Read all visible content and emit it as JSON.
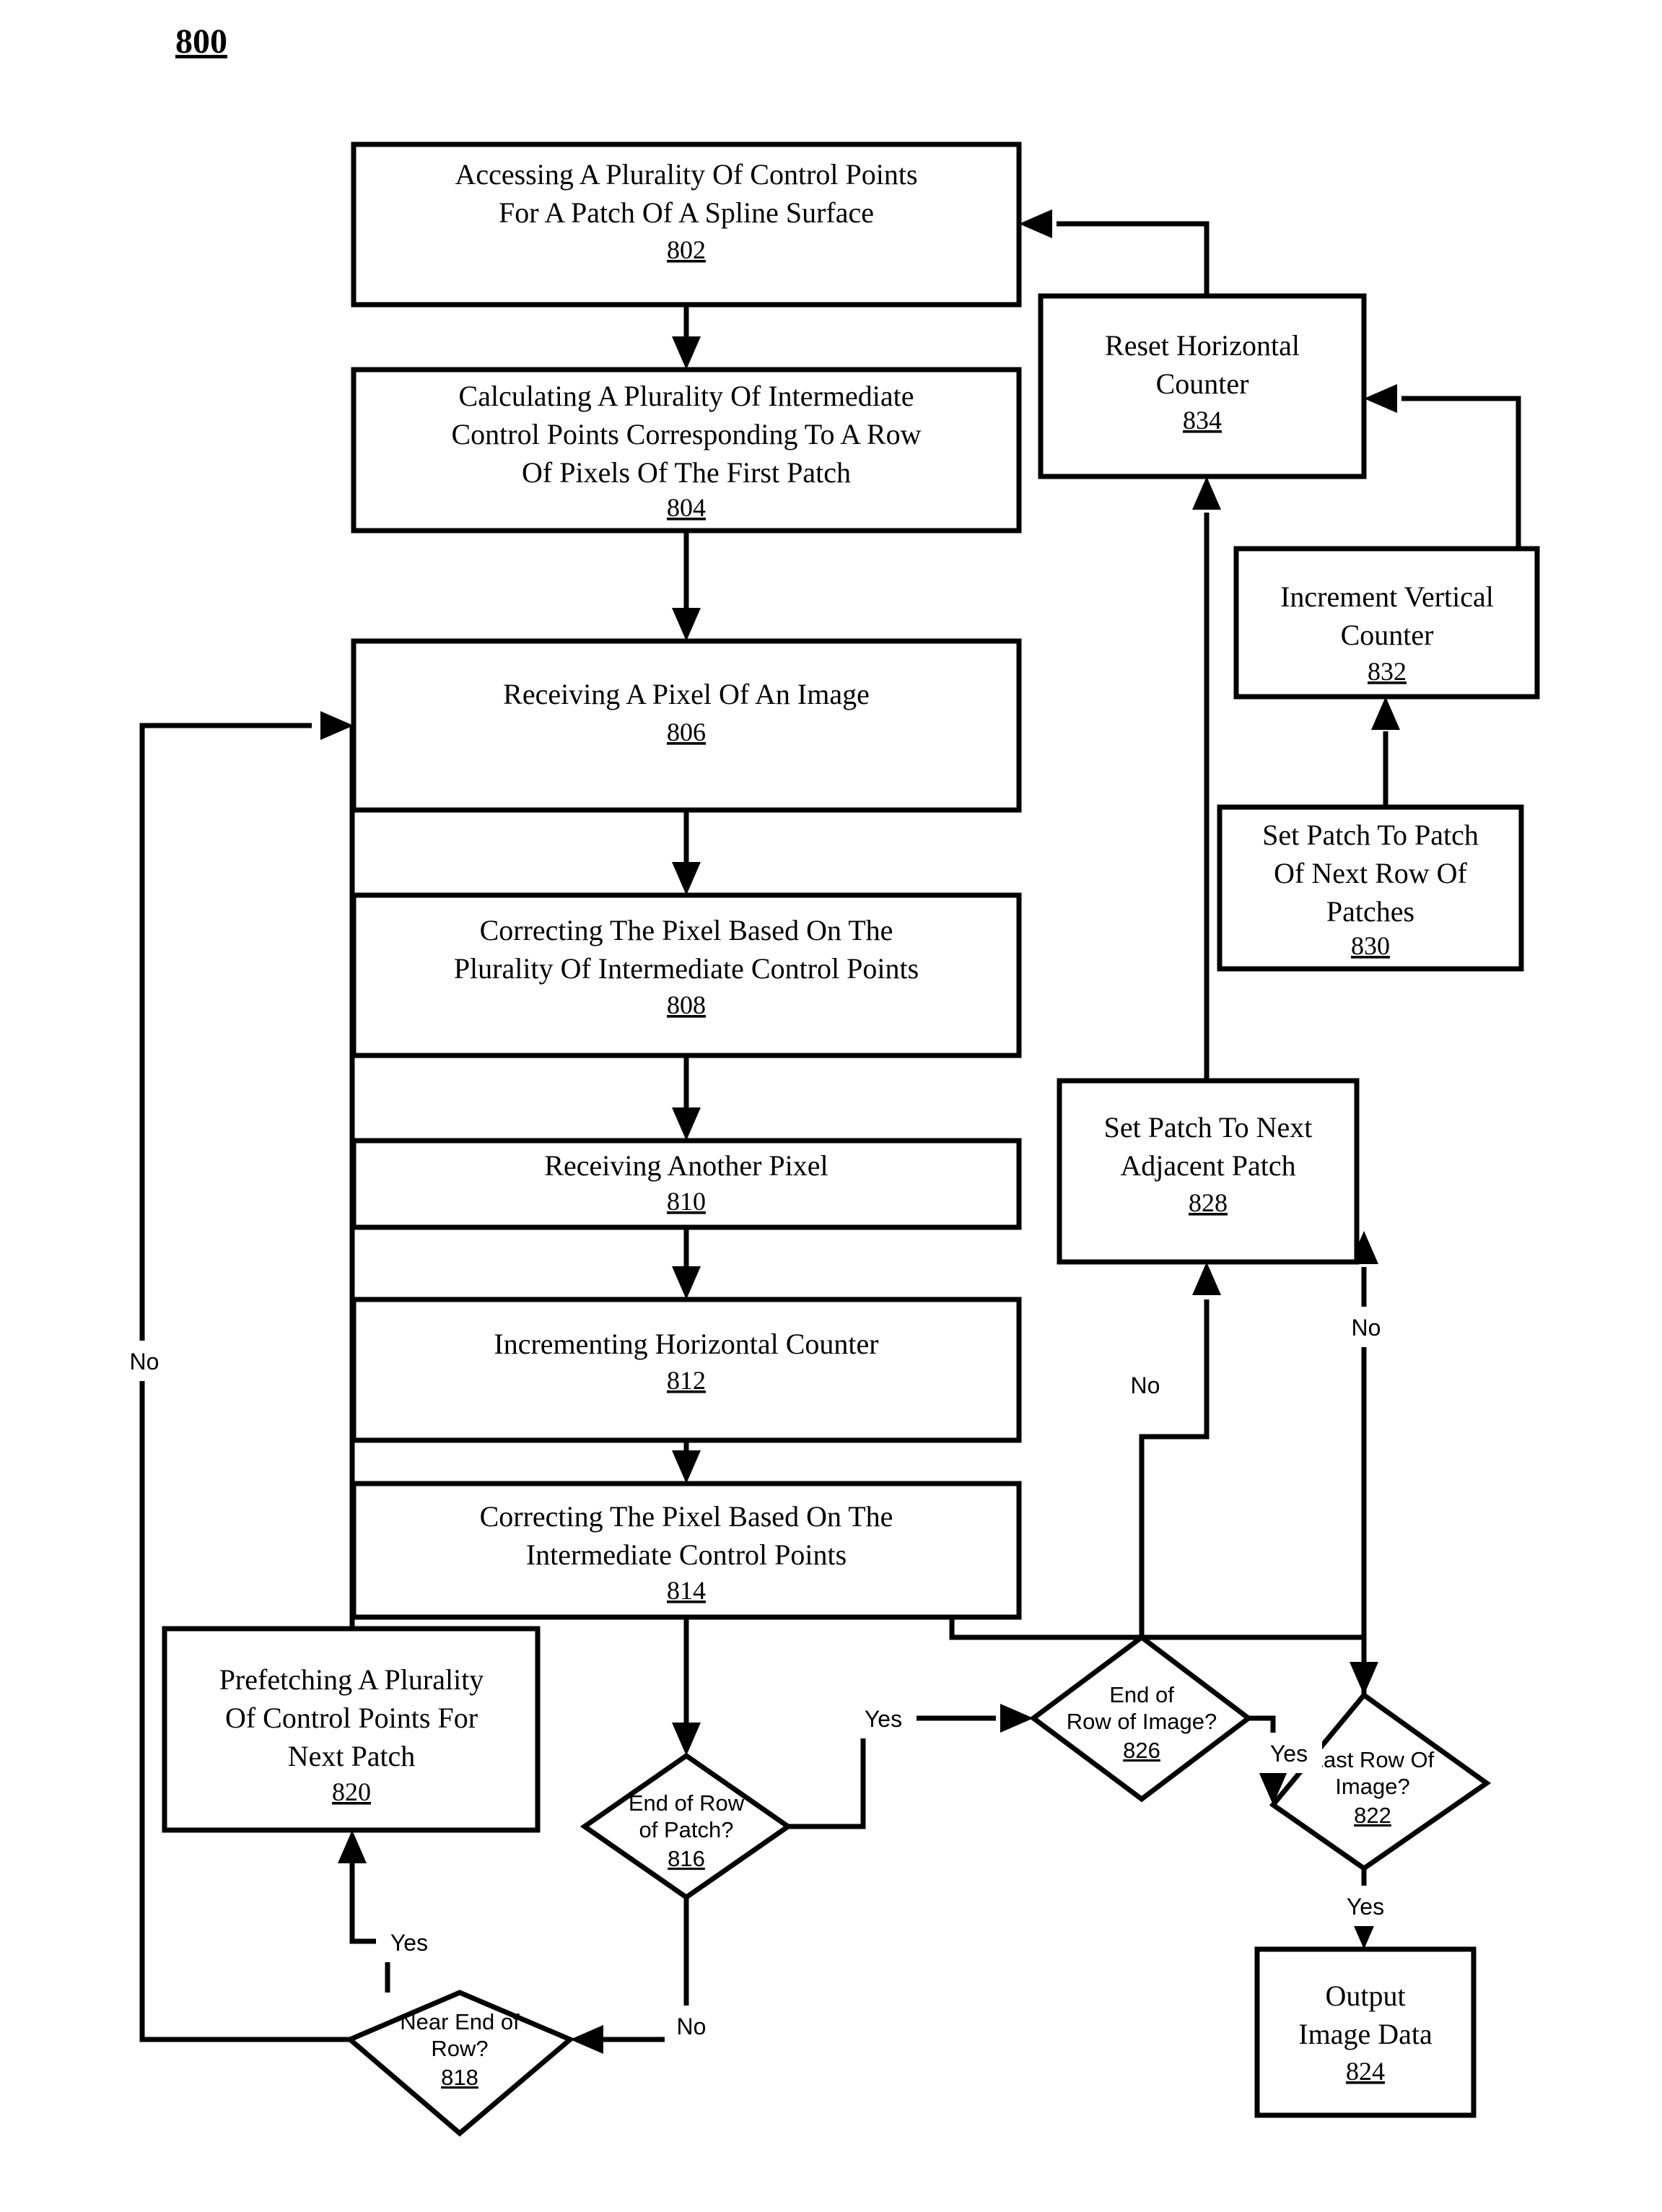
{
  "figure": {
    "number": "800"
  },
  "nodes": {
    "n802": {
      "ref": "802",
      "lines": [
        "Accessing A Plurality Of Control Points",
        "For A Patch Of A Spline Surface"
      ],
      "shape": "process"
    },
    "n804": {
      "ref": "804",
      "lines": [
        "Calculating A Plurality Of Intermediate",
        "Control Points Corresponding To A Row",
        "Of Pixels Of The First Patch"
      ],
      "shape": "process"
    },
    "n806": {
      "ref": "806",
      "lines": [
        "Receiving A Pixel Of An Image"
      ],
      "shape": "process"
    },
    "n808": {
      "ref": "808",
      "lines": [
        "Correcting The Pixel Based On The",
        "Plurality Of Intermediate Control Points"
      ],
      "shape": "process"
    },
    "n810": {
      "ref": "810",
      "lines": [
        "Receiving Another  Pixel"
      ],
      "shape": "process"
    },
    "n812": {
      "ref": "812",
      "lines": [
        "Incrementing Horizontal Counter"
      ],
      "shape": "process"
    },
    "n814": {
      "ref": "814",
      "lines": [
        "Correcting The Pixel Based On The",
        "Intermediate Control Points"
      ],
      "shape": "process"
    },
    "n816": {
      "ref": "816",
      "lines": [
        "End of Row",
        "of Patch?"
      ],
      "shape": "decision"
    },
    "n818": {
      "ref": "818",
      "lines": [
        "Near End of",
        "Row?"
      ],
      "shape": "decision"
    },
    "n820": {
      "ref": "820",
      "lines": [
        "Prefetching A Plurality",
        "Of Control Points For",
        "Next Patch"
      ],
      "shape": "process"
    },
    "n822": {
      "ref": "822",
      "lines": [
        "Last Row Of",
        "Image?"
      ],
      "shape": "decision"
    },
    "n824": {
      "ref": "824",
      "lines": [
        "Output",
        "Image Data"
      ],
      "shape": "process"
    },
    "n826": {
      "ref": "826",
      "lines": [
        "End of",
        "Row of Image?"
      ],
      "shape": "decision"
    },
    "n828": {
      "ref": "828",
      "lines": [
        "Set Patch To Next",
        "Adjacent Patch"
      ],
      "shape": "process"
    },
    "n830": {
      "ref": "830",
      "lines": [
        "Set Patch To Patch",
        "Of Next Row Of",
        "Patches"
      ],
      "shape": "process"
    },
    "n832": {
      "ref": "832",
      "lines": [
        "Increment Vertical",
        "Counter"
      ],
      "shape": "process"
    },
    "n834": {
      "ref": "834",
      "lines": [
        "Reset Horizontal",
        "Counter"
      ],
      "shape": "process"
    }
  },
  "edge_labels": {
    "e816_yes": "Yes",
    "e816_no": "No",
    "e818_yes": "Yes",
    "e818_no": "No",
    "e826_yes": "Yes",
    "e826_no": "No",
    "e822_yes": "Yes",
    "e822_no": "No"
  },
  "colors": {
    "stroke": "#000000",
    "fill": "#ffffff"
  }
}
